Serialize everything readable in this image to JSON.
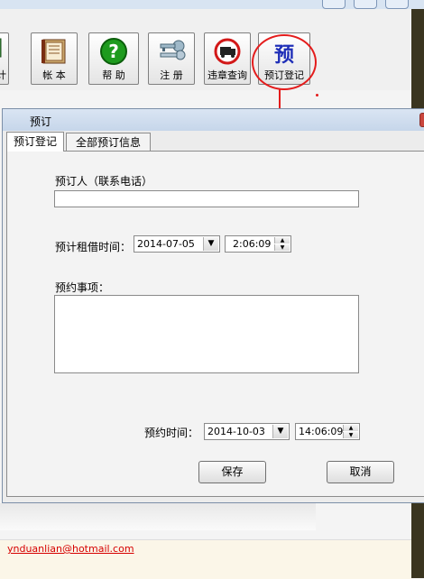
{
  "toolbar": {
    "buttons": [
      {
        "label": "计",
        "icon": "calculator-icon"
      },
      {
        "label": "帐 本",
        "icon": "book-icon"
      },
      {
        "label": "帮 助",
        "icon": "help-icon"
      },
      {
        "label": "注 册",
        "icon": "keys-icon"
      },
      {
        "label": "违章查询",
        "icon": "no-truck-icon"
      },
      {
        "label": "预订登记",
        "icon": "reserve-icon",
        "icon_text": "预"
      }
    ]
  },
  "annotation": {
    "color": "#e41c1c"
  },
  "dialog": {
    "title": "预订",
    "tabs": [
      "预订登记",
      "全部预订信息"
    ],
    "form": {
      "booker_label": "预订人（联系电话）",
      "booker_value": "",
      "rent_time_label": "预计租借时间：",
      "rent_date": "2014-07-05",
      "rent_time": "2:06:09",
      "notes_label": "预约事项：",
      "notes_value": "",
      "reserve_time_label": "预约时间：",
      "reserve_date": "2014-10-03",
      "reserve_time": "14:06:09"
    },
    "buttons": {
      "save": "保存",
      "cancel": "取消"
    }
  },
  "footer": {
    "email": "ynduanlian@hotmail.com"
  }
}
